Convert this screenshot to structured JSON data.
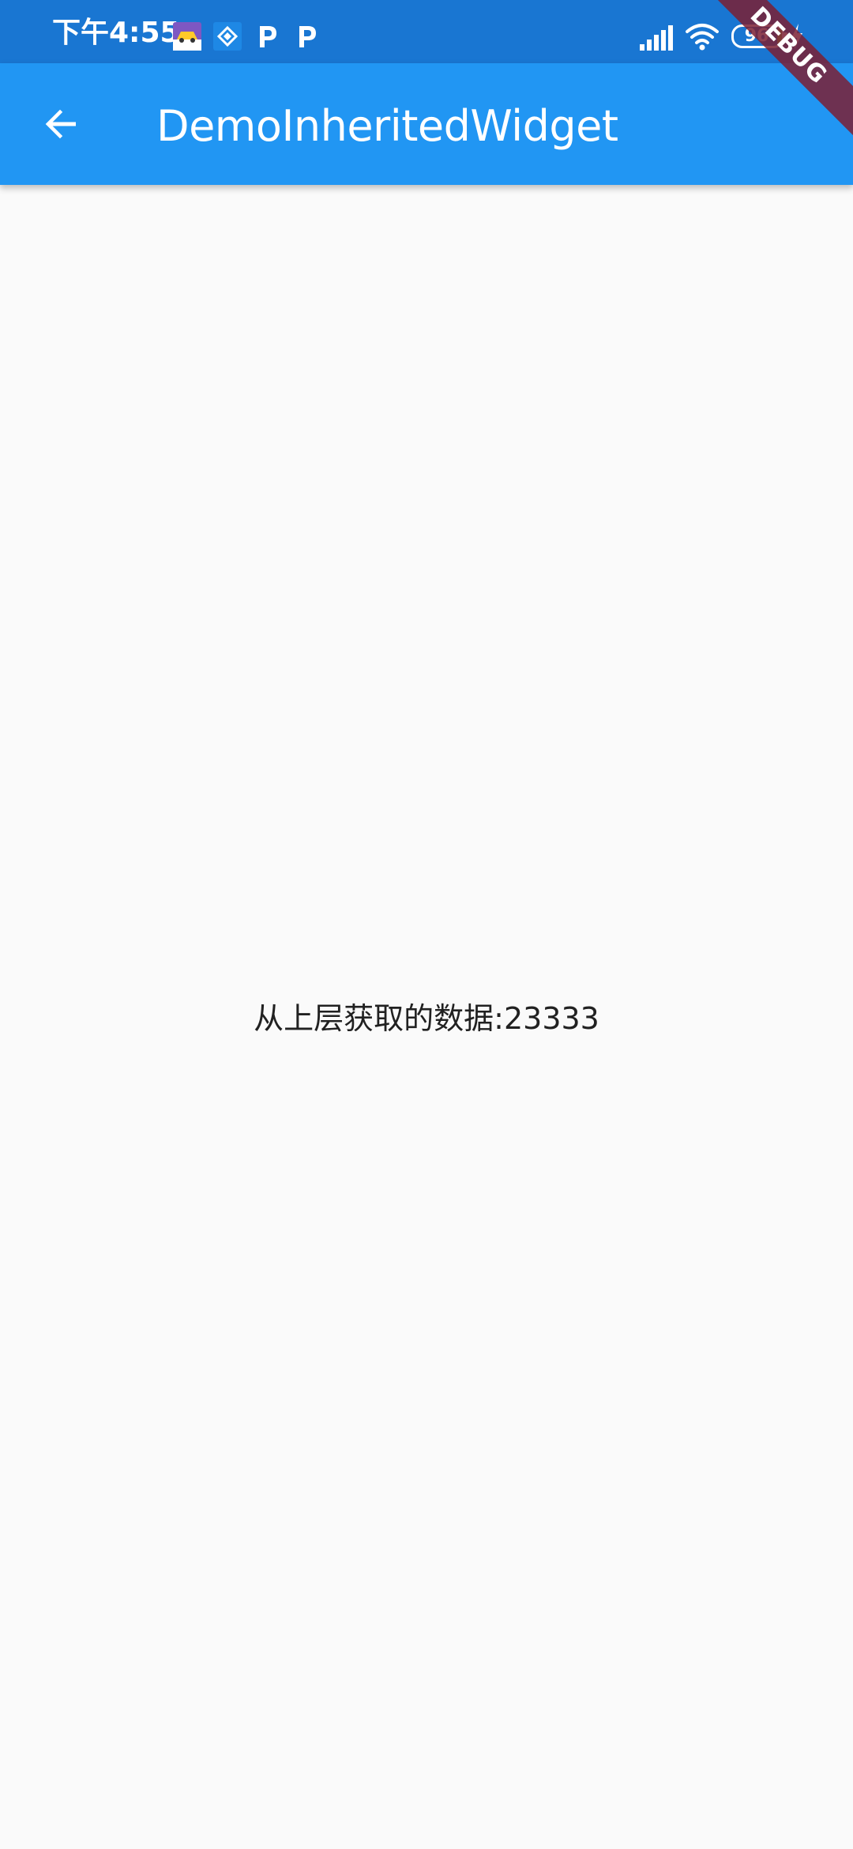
{
  "status_bar": {
    "time": "下午4:55",
    "battery_level": "96",
    "notification_icons": [
      "app-icon",
      "app-icon",
      "p-icon",
      "p-icon"
    ],
    "icons": [
      "signal-icon",
      "wifi-icon",
      "battery-icon",
      "charging-icon"
    ]
  },
  "app_bar": {
    "title": "DemoInheritedWidget",
    "back_icon": "arrow-back-icon",
    "color": "#2196f3"
  },
  "debug_banner": {
    "label": "DEBUG",
    "color": "#7b2034"
  },
  "body": {
    "text": "从上层获取的数据:23333",
    "background": "#fafafa"
  },
  "colors": {
    "status_bar": "#1976d2",
    "primary": "#2196f3",
    "text": "#212121"
  }
}
